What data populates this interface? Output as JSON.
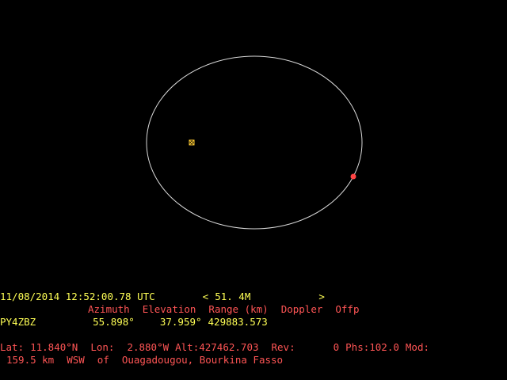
{
  "colors": {
    "background": "#000000",
    "orbit": "#d8d8d8",
    "satellite": "#ff4444",
    "ground_marker": "#ffcc33",
    "text_yellow": "#ffff55",
    "text_red": "#ff5555"
  },
  "status": {
    "datetime": "11/08/2014 12:52:00.78 UTC",
    "mode_open": "<",
    "mode": "51. 4M",
    "mode_close": ">"
  },
  "headers": {
    "azimuth": "Azimuth",
    "elevation": "Elevation",
    "range": "Range (km)",
    "doppler": "Doppler",
    "offp": "Offp"
  },
  "observer": {
    "callsign": "PY4ZBZ",
    "azimuth": "55.898°",
    "elevation": "37.959°",
    "range": "429883.573"
  },
  "position": {
    "lat_label": "Lat:",
    "lat": "11.840°N",
    "lon_label": "Lon:",
    "lon": "2.880°W",
    "alt_label": "Alt:",
    "alt": "427462.703",
    "rev_label": "Rev:",
    "rev": "0",
    "phs_label": "Phs:",
    "phs": "102.0",
    "mod_label": "Mod:"
  },
  "location": {
    "distance": "159.5 km",
    "direction": "WSW",
    "of": "of",
    "place": "Ouagadougou, Bourkina Fasso"
  }
}
